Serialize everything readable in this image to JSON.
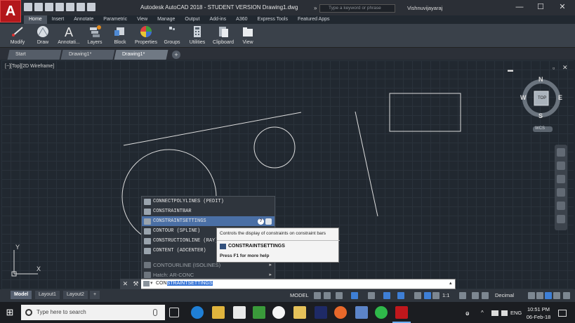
{
  "window": {
    "logo_letter": "A",
    "title": "Autodesk AutoCAD 2018 - STUDENT VERSION    Drawing1.dwg",
    "search_placeholder": "Type a keyword or phrase",
    "user": "Vishnuvijayaraj",
    "minimize": "—",
    "maximize": "☐",
    "close": "✕"
  },
  "ribbon_tabs": [
    "Home",
    "Insert",
    "Annotate",
    "Parametric",
    "View",
    "Manage",
    "Output",
    "Add-ins",
    "A360",
    "Express Tools",
    "Featured Apps"
  ],
  "ribbon_panels": [
    {
      "label": "Modify",
      "icon": "modify-icon"
    },
    {
      "label": "Draw",
      "icon": "draw-icon"
    },
    {
      "label": "Annotati...",
      "icon": "annotation-icon"
    },
    {
      "label": "Layers",
      "icon": "layers-icon"
    },
    {
      "label": "Block",
      "icon": "block-icon"
    },
    {
      "label": "Properties",
      "icon": "properties-icon"
    },
    {
      "label": "Groups",
      "icon": "groups-icon"
    },
    {
      "label": "Utilities",
      "icon": "utilities-icon"
    },
    {
      "label": "Clipboard",
      "icon": "clipboard-icon"
    },
    {
      "label": "View",
      "icon": "view-icon"
    }
  ],
  "doc_tabs": [
    "Start",
    "Drawing1*",
    "Drawing1*"
  ],
  "viewport": {
    "label": "[−][Top][2D Wireframe]",
    "viewcube": {
      "top": "TOP",
      "north": "N",
      "south": "S",
      "east": "E",
      "west": "W",
      "wcs": "WCS"
    },
    "ucs_y": "Y",
    "ucs_x": "X"
  },
  "autocomplete": [
    {
      "text": "CONNECTPOLYLINES (PEDIT)",
      "state": "normal"
    },
    {
      "text": "CONSTRAINTBAR",
      "state": "normal"
    },
    {
      "text": "CONSTRAINTSETTINGS",
      "state": "selected"
    },
    {
      "text": "CONTOUR (SPLINE)",
      "state": "normal"
    },
    {
      "text": "CONSTRUCTIONLINE (RAY)",
      "state": "normal"
    },
    {
      "text": "CONTENT (ADCENTER)",
      "state": "normal"
    },
    {
      "text": "CONTOURLINE (ISOLINES)",
      "state": "dim"
    },
    {
      "text": "Hatch: AR-CONC",
      "state": "dim"
    }
  ],
  "tooltip": {
    "description": "Controls the display of constraints on constraint bars",
    "command": "CONSTRAINTSETTINGS",
    "help": "Press F1 for more help"
  },
  "command_line": {
    "typed": "CON",
    "completion": "STRAINTSETTINGS"
  },
  "layout_tabs": [
    "Model",
    "Layout1",
    "Layout2",
    "+"
  ],
  "status": {
    "model": "MODEL",
    "scale": "1:1",
    "units": "Decimal"
  },
  "taskbar": {
    "search_placeholder": "Type here to search",
    "language": "ENG",
    "time": "10:51 PM",
    "date": "06-Feb-18"
  }
}
